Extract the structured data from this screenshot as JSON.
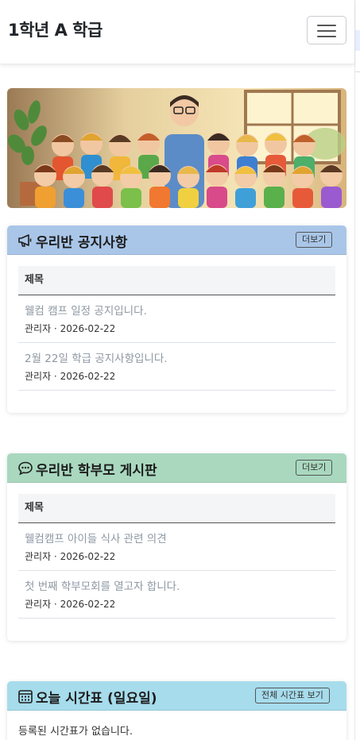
{
  "navbar": {
    "brand": "1학년 A 학급",
    "menu_icon": "hamburger-icon"
  },
  "banner": {
    "alt": "teacher-and-students-illustration"
  },
  "notice": {
    "title": "우리반 공지사항",
    "icon": "megaphone-icon",
    "header_color": "#a9c6e8",
    "more_label": "더보기",
    "column": "제목",
    "items": [
      {
        "title": "웰컴 캠프 일정 공지입니다.",
        "meta": "관리자 · 2026-02-22"
      },
      {
        "title": "2월 22일 학급 공지사항입니다.",
        "meta": "관리자 · 2026-02-22"
      }
    ]
  },
  "board": {
    "title": "우리반 학부모 게시판",
    "icon": "chat-bubble-icon",
    "header_color": "#a9d8bf",
    "more_label": "더보기",
    "column": "제목",
    "items": [
      {
        "title": "웰컴캠프 아이들 식사 관련 의견",
        "meta": "관리자 · 2026-02-22"
      },
      {
        "title": "첫 번째 학부모회를 열고자 합니다.",
        "meta": "관리자 · 2026-02-22"
      }
    ]
  },
  "timetable": {
    "title": "오늘 시간표 (일요일)",
    "icon": "calendar-icon",
    "header_color": "#a6dcec",
    "more_label": "전체 시간표 보기",
    "empty_message": "등록된 시간표가 없습니다."
  }
}
